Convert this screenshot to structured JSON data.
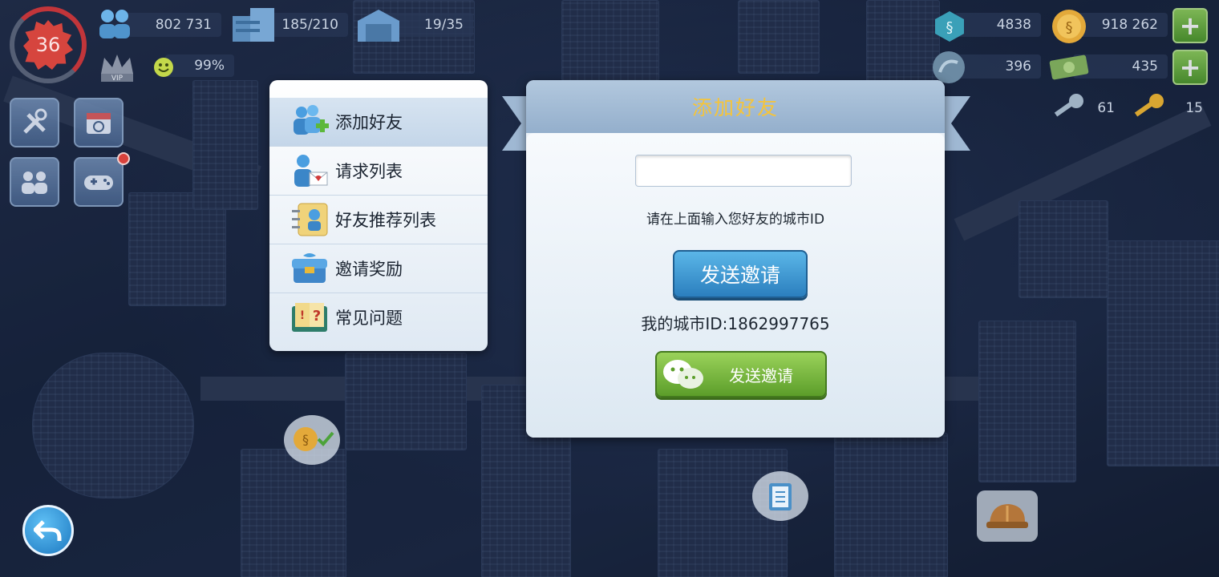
{
  "hud": {
    "level": "36",
    "population": "802 731",
    "storage": "185/210",
    "vehicles": "19/35",
    "happiness": "99%",
    "vip_label": "VIP",
    "simcash": "4838",
    "simoleons": "918 262",
    "neosimoleons": "396",
    "regional_currency": "435",
    "keys_silver": "61",
    "keys_gold": "15"
  },
  "menu": {
    "items": [
      {
        "label": "添加好友",
        "icon": "add-friend-icon"
      },
      {
        "label": "请求列表",
        "icon": "request-list-icon"
      },
      {
        "label": "好友推荐列表",
        "icon": "recommend-list-icon"
      },
      {
        "label": "邀请奖励",
        "icon": "reward-chest-icon"
      },
      {
        "label": "常见问题",
        "icon": "faq-book-icon"
      }
    ]
  },
  "dialog": {
    "title": "添加好友",
    "input_value": "",
    "hint": "请在上面输入您好友的城市ID",
    "send_label": "发送邀请",
    "my_city_id": "我的城市ID:1862997765",
    "wechat_send_label": "发送邀请"
  },
  "colors": {
    "title_gold": "#f5c43a",
    "send_blue": "#2b7fbe",
    "wechat_green": "#5c9e2a",
    "level_red": "#d6453e"
  }
}
